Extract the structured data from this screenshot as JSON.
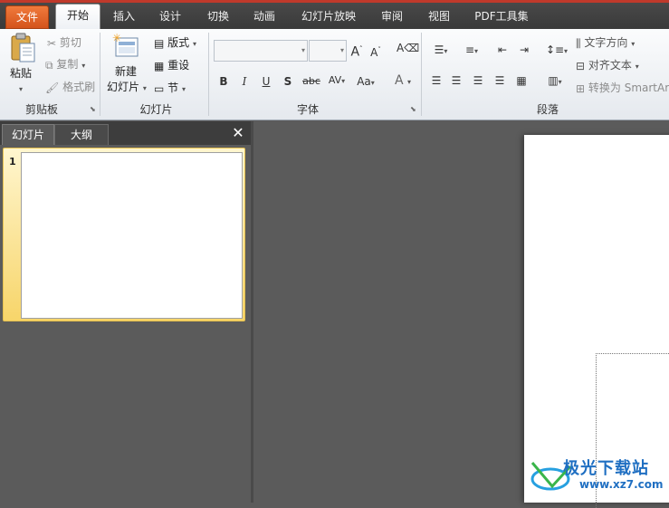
{
  "tabs": [
    "文件",
    "开始",
    "插入",
    "设计",
    "切换",
    "动画",
    "幻灯片放映",
    "审阅",
    "视图",
    "PDF工具集"
  ],
  "clipboard": {
    "paste": "粘贴",
    "cut": "剪切",
    "copy": "复制",
    "format_painter": "格式刷",
    "label": "剪贴板"
  },
  "slides_group": {
    "new_slide_line1": "新建",
    "new_slide_line2": "幻灯片",
    "layout": "版式",
    "reset": "重设",
    "section": "节",
    "label": "幻灯片"
  },
  "font": {
    "label": "字体",
    "bold": "B",
    "italic": "I",
    "underline": "U",
    "shadow": "S",
    "strike": "abc",
    "spacing": "AV",
    "case": "Aa",
    "color": "A",
    "grow": "A",
    "shrink": "A"
  },
  "paragraph": {
    "text_direction": "文字方向",
    "align_text": "对齐文本",
    "convert_smartart": "转换为 SmartArt",
    "label": "段落"
  },
  "pane": {
    "tab_slides": "幻灯片",
    "tab_outline": "大纲",
    "close": "✕",
    "slide_number": "1"
  },
  "watermark": {
    "name": "极光下载站",
    "url": "www.xz7.com"
  },
  "colors": {
    "file_tab": "#e46a2c",
    "selection": "#f7d56a",
    "watermark": "#1f6fc2"
  }
}
